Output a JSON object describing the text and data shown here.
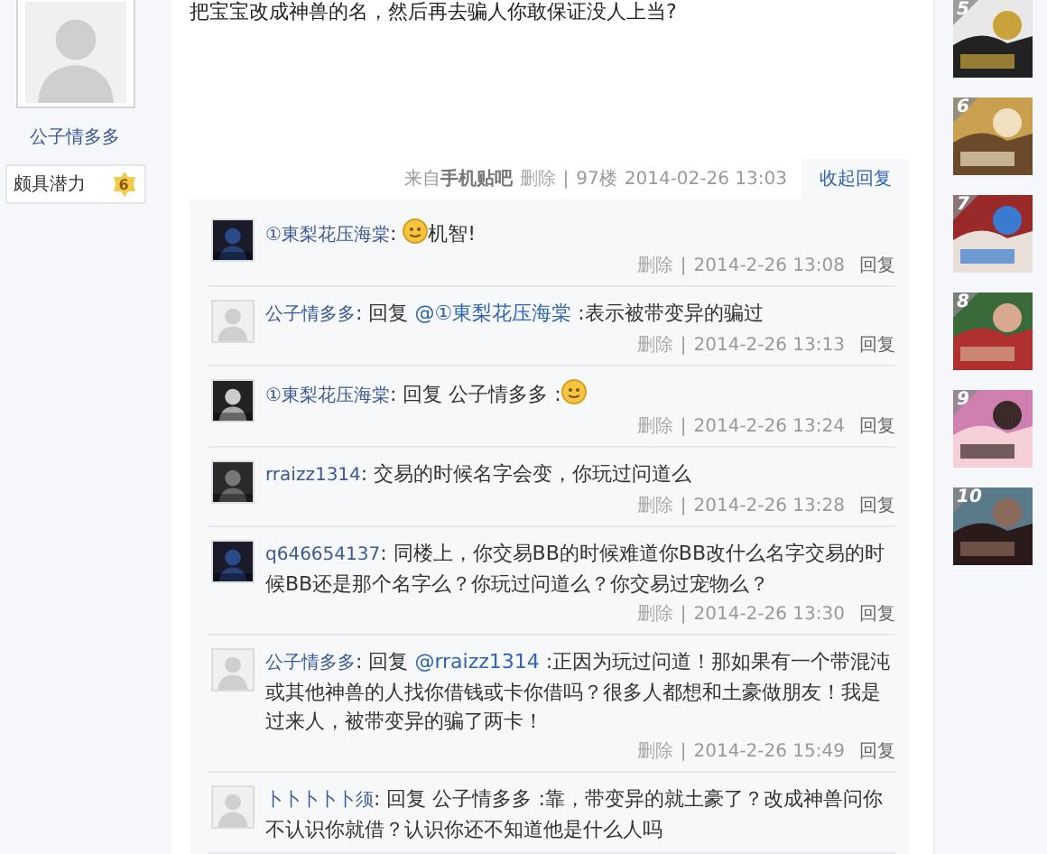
{
  "profile": {
    "avatar": {
      "kind": "default"
    },
    "name": "公子情多多",
    "badge": {
      "label": "颇具潜力",
      "level": "6"
    }
  },
  "post": {
    "text": "把宝宝改成神兽的名，然后再去骗人你敢保证没人上当?",
    "meta": {
      "source_prefix": "来自",
      "source": "手机贴吧",
      "delete": "删除",
      "separator": "|",
      "floor": "97楼",
      "time": "2014-02-26 13:03"
    },
    "collapse": "收起回复"
  },
  "comments": [
    {
      "avatar": {
        "kind": "picture"
      },
      "name": "①東梨花压海棠",
      "content": [
        {
          "kind": "text",
          "text": ": "
        },
        {
          "kind": "emoji"
        },
        {
          "kind": "text",
          "text": "机智!"
        }
      ],
      "delete": "删除",
      "separator": "|",
      "time": "2014-2-26 13:08",
      "reply": "回复"
    },
    {
      "avatar": {
        "kind": "default"
      },
      "name": "公子情多多",
      "content": [
        {
          "kind": "text",
          "text": ": 回复 "
        },
        {
          "kind": "link",
          "text": "@①東梨花压海棠"
        },
        {
          "kind": "text",
          "text": " :表示被带变异的骗过"
        }
      ],
      "delete": "删除",
      "separator": "|",
      "time": "2014-2-26 13:13",
      "reply": "回复"
    },
    {
      "avatar": {
        "kind": "picture"
      },
      "name": "①東梨花压海棠",
      "content": [
        {
          "kind": "text",
          "text": ": 回复 公子情多多 :"
        },
        {
          "kind": "emoji"
        }
      ],
      "delete": "删除",
      "separator": "|",
      "time": "2014-2-26 13:24",
      "reply": "回复"
    },
    {
      "avatar": {
        "kind": "picture"
      },
      "name": "rraizz1314",
      "content": [
        {
          "kind": "text",
          "text": ": 交易的时候名字会变，你玩过问道么"
        }
      ],
      "delete": "删除",
      "separator": "|",
      "time": "2014-2-26 13:28",
      "reply": "回复"
    },
    {
      "avatar": {
        "kind": "picture"
      },
      "name": "q646654137",
      "content": [
        {
          "kind": "text",
          "text": ": 同楼上，你交易BB的时候难道你BB改什么名字交易的时候BB还是那个名字么？你玩过问道么？你交易过宠物么？"
        }
      ],
      "delete": "删除",
      "separator": "|",
      "time": "2014-2-26 13:30",
      "reply": "回复"
    },
    {
      "avatar": {
        "kind": "default"
      },
      "name": "公子情多多",
      "content": [
        {
          "kind": "text",
          "text": ": 回复 "
        },
        {
          "kind": "link",
          "text": "@rraizz1314"
        },
        {
          "kind": "text",
          "text": " :正因为玩过问道！那如果有一个带混沌或其他神兽的人找你借钱或卡你借吗？很多人都想和土豪做朋友！我是过来人，被带变异的骗了两卡！"
        }
      ],
      "delete": "删除",
      "separator": "|",
      "time": "2014-2-26 15:49",
      "reply": "回复"
    },
    {
      "avatar": {
        "kind": "default"
      },
      "name": "卜卜卜卜卜须",
      "content": [
        {
          "kind": "text",
          "text": ": 回复 公子情多多 :靠，带变异的就土豪了？改成神兽问你不认识你就借？认识你还不知道他是什么人吗"
        }
      ]
    }
  ],
  "ranking": [
    {
      "rank": "5"
    },
    {
      "rank": "6"
    },
    {
      "rank": "7"
    },
    {
      "rank": "8"
    },
    {
      "rank": "9"
    },
    {
      "rank": "10"
    }
  ]
}
